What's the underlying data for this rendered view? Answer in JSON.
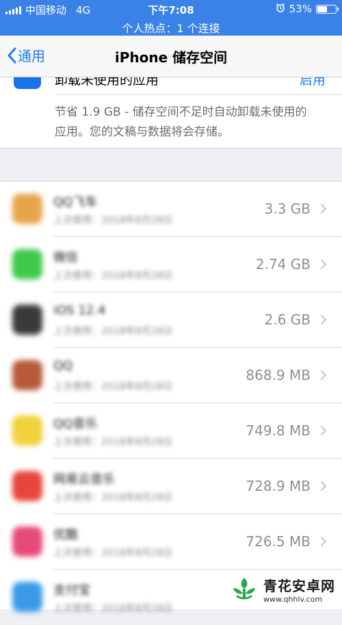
{
  "status_bar": {
    "carrier": "中国移动",
    "network": "4G",
    "time": "下午7:08",
    "battery": "53%",
    "hotspot": "个人热点：1 个连接"
  },
  "nav": {
    "back_label": "通用",
    "title": "iPhone 储存空间"
  },
  "offload": {
    "title": "卸载未使用的应用",
    "action": "启用",
    "description": "节省 1.9 GB - 储存空间不足时自动卸载未使用的应用。您的文稿与数据将会存储。"
  },
  "apps": [
    {
      "name": "QQ飞车",
      "sub": "上次使用：2018年8月28日",
      "size": "3.3 GB",
      "color": "#e8a44a"
    },
    {
      "name": "微信",
      "sub": "上次使用：2018年8月28日",
      "size": "2.74 GB",
      "color": "#3ec94a"
    },
    {
      "name": "iOS 12.4",
      "sub": "上次使用：2018年8月28日",
      "size": "2.6 GB",
      "color": "#3a3a3a"
    },
    {
      "name": "QQ",
      "sub": "上次使用：2018年8月28日",
      "size": "868.9 MB",
      "color": "#b85a3a"
    },
    {
      "name": "QQ音乐",
      "sub": "上次使用：2018年8月28日",
      "size": "749.8 MB",
      "color": "#f0d23a"
    },
    {
      "name": "网易云音乐",
      "sub": "上次使用：2018年8月28日",
      "size": "728.9 MB",
      "color": "#e8463c"
    },
    {
      "name": "优酷",
      "sub": "上次使用：2018年8月28日",
      "size": "726.5 MB",
      "color": "#e64a7a"
    },
    {
      "name": "支付宝",
      "sub": "上次使用：2018年8月28日",
      "size": "",
      "color": "#3a9ae8"
    }
  ],
  "watermark": {
    "text": "青花安卓网",
    "url": "www.qhhlv.com"
  }
}
